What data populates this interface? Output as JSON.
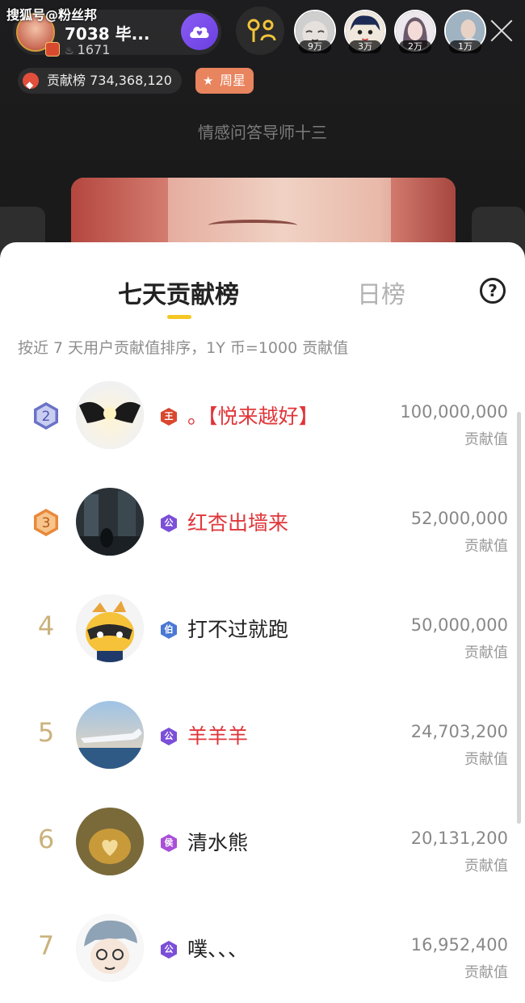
{
  "watermark": "搜狐号@粉丝邦",
  "host": {
    "name": "7038 毕...",
    "fans": "1671"
  },
  "viewers": [
    {
      "count": "9万"
    },
    {
      "count": "3万"
    },
    {
      "count": "2万"
    },
    {
      "count": "1万"
    }
  ],
  "contribution": {
    "label": "贡献榜",
    "value": "734,368,120"
  },
  "weekly_star": "周星",
  "room_caption": "情感问答导师十三",
  "sheet": {
    "tab_week": "七天贡献榜",
    "tab_day": "日榜",
    "help": "?",
    "rule": "按近 7 天用户贡献值排序，1Y 币=1000 贡献值"
  },
  "ranking": [
    {
      "rank": "2",
      "badge": "王",
      "badge_color": "#d9472f",
      "name": "。【悦来越好】",
      "name_color": "red",
      "score": "100,000,000",
      "score_label": "贡献值"
    },
    {
      "rank": "3",
      "badge": "公",
      "badge_color": "#7b4fd8",
      "name": "红杏出墙来",
      "name_color": "red",
      "score": "52,000,000",
      "score_label": "贡献值"
    },
    {
      "rank": "4",
      "badge": "伯",
      "badge_color": "#4a78d4",
      "name": "打不过就跑",
      "name_color": "dark",
      "score": "50,000,000",
      "score_label": "贡献值"
    },
    {
      "rank": "5",
      "badge": "公",
      "badge_color": "#7b4fd8",
      "name": "羊羊羊",
      "name_color": "red",
      "score": "24,703,200",
      "score_label": "贡献值"
    },
    {
      "rank": "6",
      "badge": "侯",
      "badge_color": "#a94fd8",
      "name": "清水熊",
      "name_color": "dark",
      "score": "20,131,200",
      "score_label": "贡献值"
    },
    {
      "rank": "7",
      "badge": "公",
      "badge_color": "#7b4fd8",
      "name": "噗、、、",
      "name_color": "dark",
      "score": "16,952,400",
      "score_label": "贡献值"
    }
  ],
  "colors": {
    "accent": "#f6c623",
    "name_red": "#e0363a",
    "rank2_medal": "#6a73c7",
    "rank3_medal": "#e8893a"
  }
}
